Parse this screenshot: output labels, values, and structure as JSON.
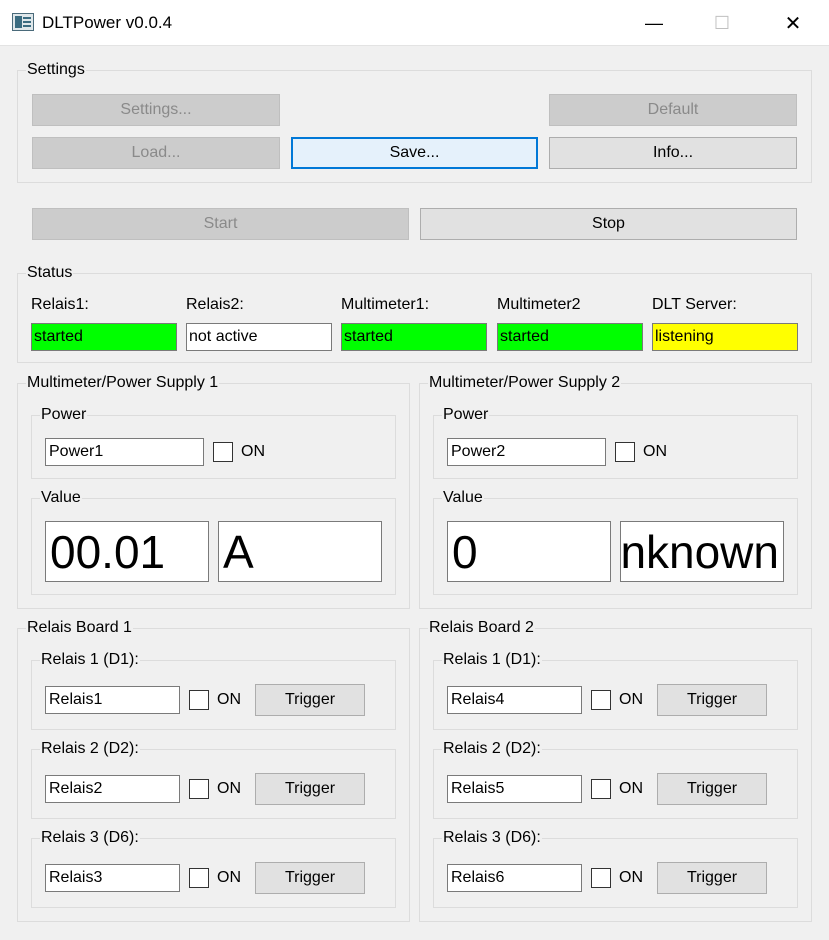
{
  "window": {
    "title": "DLTPower v0.0.4",
    "minimize_glyph": "—",
    "maximize_glyph": "☐",
    "close_glyph": "✕"
  },
  "settings": {
    "group_title": "Settings",
    "settings_button": "Settings...",
    "default_button": "Default",
    "load_button": "Load...",
    "save_button": "Save...",
    "info_button": "Info..."
  },
  "controls": {
    "start_button": "Start",
    "stop_button": "Stop"
  },
  "status": {
    "group_title": "Status",
    "items": [
      {
        "label": "Relais1:",
        "value": "started",
        "color": "#00ff00"
      },
      {
        "label": "Relais2:",
        "value": "not active",
        "color": "#ffffff"
      },
      {
        "label": "Multimeter1:",
        "value": "started",
        "color": "#00ff00"
      },
      {
        "label": "Multimeter2",
        "value": "started",
        "color": "#00ff00"
      },
      {
        "label": "DLT Server:",
        "value": "listening",
        "color": "#ffff00"
      }
    ]
  },
  "multimeters": [
    {
      "title": "Multimeter/Power Supply 1",
      "power_label": "Power",
      "power_name": "Power1",
      "on_label": "ON",
      "value_label": "Value",
      "value": "00.01",
      "unit": "A"
    },
    {
      "title": "Multimeter/Power Supply 2",
      "power_label": "Power",
      "power_name": "Power2",
      "on_label": "ON",
      "value_label": "Value",
      "value": "0",
      "unit": "nknown"
    }
  ],
  "relais_boards": [
    {
      "title": "Relais Board 1",
      "relais": [
        {
          "label": "Relais 1 (D1):",
          "name": "Relais1",
          "on_label": "ON",
          "trigger": "Trigger"
        },
        {
          "label": "Relais 2 (D2):",
          "name": "Relais2",
          "on_label": "ON",
          "trigger": "Trigger"
        },
        {
          "label": "Relais 3 (D6):",
          "name": "Relais3",
          "on_label": "ON",
          "trigger": "Trigger"
        }
      ]
    },
    {
      "title": "Relais Board 2",
      "relais": [
        {
          "label": "Relais 1 (D1):",
          "name": "Relais4",
          "on_label": "ON",
          "trigger": "Trigger"
        },
        {
          "label": "Relais 2 (D2):",
          "name": "Relais5",
          "on_label": "ON",
          "trigger": "Trigger"
        },
        {
          "label": "Relais 3 (D6):",
          "name": "Relais6",
          "on_label": "ON",
          "trigger": "Trigger"
        }
      ]
    }
  ]
}
